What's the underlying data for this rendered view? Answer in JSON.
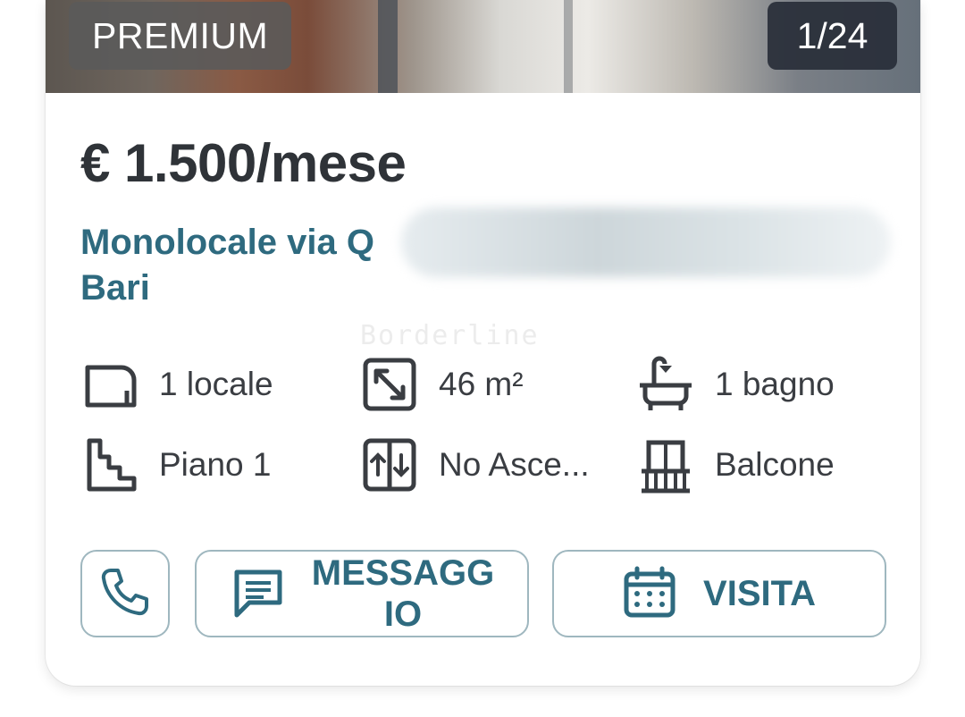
{
  "listing": {
    "badge": "PREMIUM",
    "photo_counter": "1/24",
    "price": "€ 1.500/mese",
    "title_line1": "Monolocale via Q",
    "title_line2": "Bari",
    "watermark": "Borderline"
  },
  "features": [
    {
      "icon": "room-icon",
      "label": "1 locale"
    },
    {
      "icon": "area-icon",
      "label": "46 m²"
    },
    {
      "icon": "bathtub-icon",
      "label": "1 bagno"
    },
    {
      "icon": "stairs-icon",
      "label": "Piano 1"
    },
    {
      "icon": "elevator-icon",
      "label": "No Asce..."
    },
    {
      "icon": "balcony-icon",
      "label": "Balcone"
    }
  ],
  "actions": {
    "call_icon": "phone-icon",
    "message_label_line1": "MESSAGG",
    "message_label_line2": "IO",
    "visit_label": "VISITA"
  },
  "colors": {
    "accent": "#2e6a7f",
    "text": "#2f3338",
    "button_border": "#9fb7bf"
  }
}
